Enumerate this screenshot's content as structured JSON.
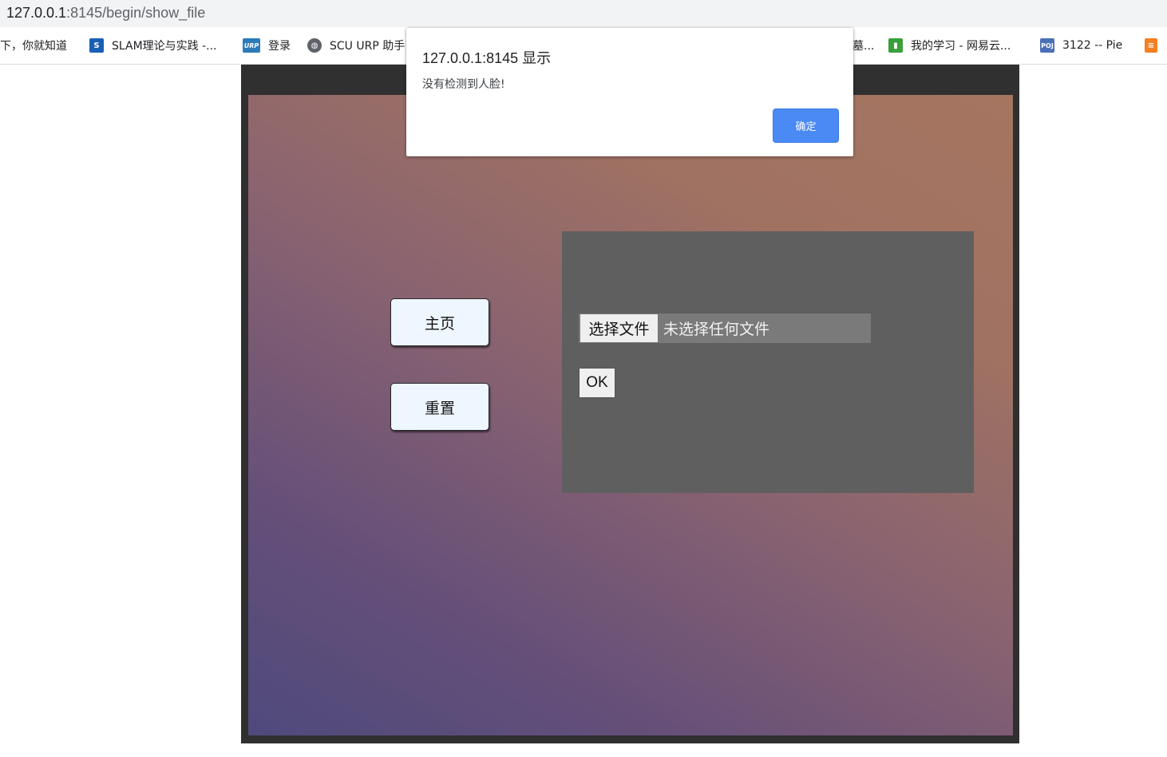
{
  "browser": {
    "url_host": "127.0.0.1",
    "url_path": ":8145/begin/show_file",
    "bookmarks": [
      {
        "label": "下，你就知道",
        "icon": ""
      },
      {
        "label": "SLAM理论与实践 -...",
        "icon": "S"
      },
      {
        "label": "登录",
        "icon": "URP"
      },
      {
        "label": "SCU URP 助手",
        "icon": "globe-icon"
      },
      {
        "label": "墓...",
        "icon": ""
      },
      {
        "label": "我的学习 - 网易云...",
        "icon": "book-icon"
      },
      {
        "label": "3122 -- Pie",
        "icon": "POJ"
      },
      {
        "label": "",
        "icon": "stack-icon"
      }
    ]
  },
  "page": {
    "home_label": "主页",
    "reset_label": "重置",
    "choose_file_label": "选择文件",
    "no_file_label": "未选择任何文件",
    "ok_label": "OK"
  },
  "dialog": {
    "title": "127.0.0.1:8145 显示",
    "message": "没有检测到人脸!",
    "confirm_label": "确定",
    "confirm_color": "#4a8af4"
  }
}
